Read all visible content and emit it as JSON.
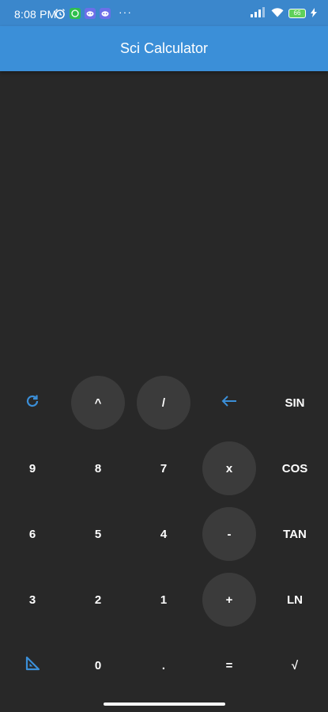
{
  "status_bar": {
    "time": "8:08 PM",
    "more": "···",
    "battery": "66",
    "icons": [
      "alarm-icon",
      "whatsapp-icon",
      "discord-icon",
      "discord-icon",
      "signal-icon",
      "wifi-icon",
      "battery-icon",
      "charging-icon"
    ]
  },
  "app": {
    "title": "Sci Calculator",
    "accent_color": "#3b8fd8"
  },
  "keypad": {
    "rows": [
      [
        "refresh-icon",
        "^",
        "/",
        "backspace-icon",
        "SIN"
      ],
      [
        "9",
        "8",
        "7",
        "x",
        "COS"
      ],
      [
        "6",
        "5",
        "4",
        "-",
        "TAN"
      ],
      [
        "3",
        "2",
        "1",
        "+",
        "LN"
      ],
      [
        "angle-icon",
        "0",
        ".",
        "=",
        "√"
      ]
    ]
  }
}
